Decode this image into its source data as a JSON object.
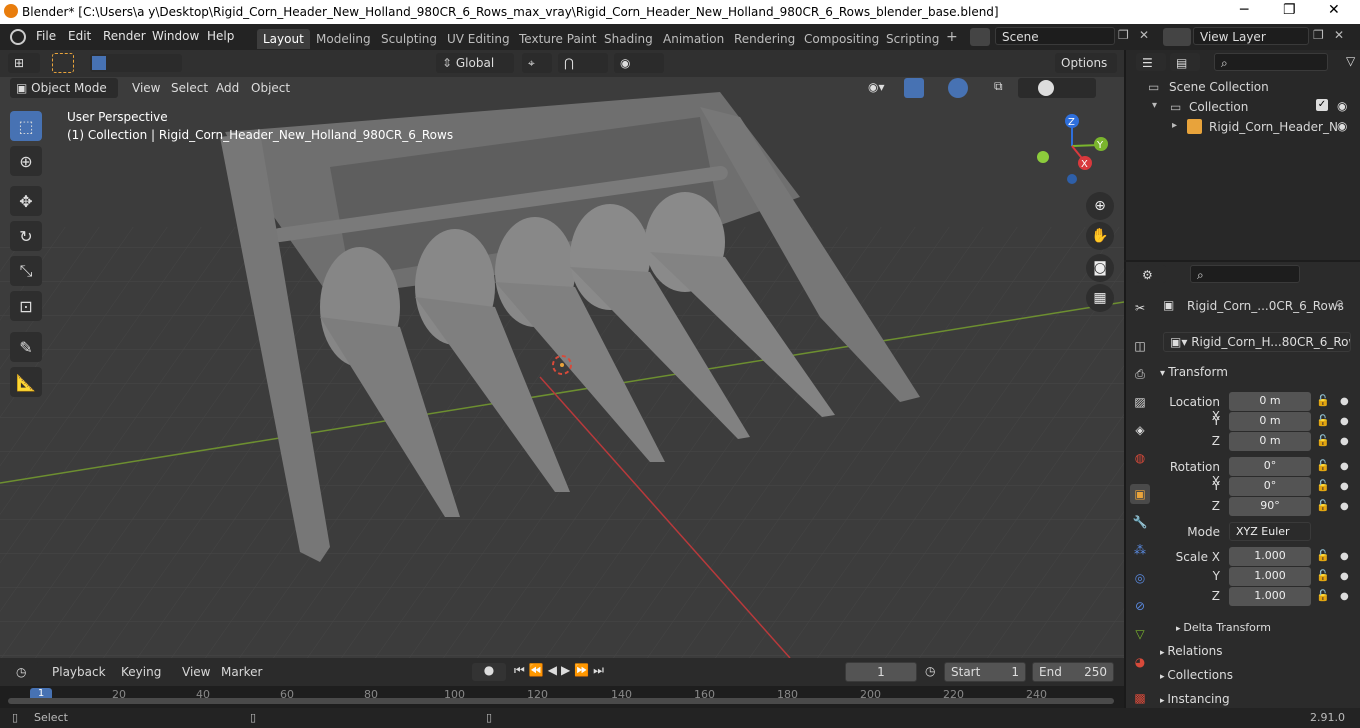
{
  "window": {
    "title": "Blender* [C:\\Users\\a y\\Desktop\\Rigid_Corn_Header_New_Holland_980CR_6_Rows_max_vray\\Rigid_Corn_Header_New_Holland_980CR_6_Rows_blender_base.blend]",
    "minimize": "─",
    "maximize": "❐",
    "close": "✕"
  },
  "menubar": [
    "File",
    "Edit",
    "Render",
    "Window",
    "Help"
  ],
  "workspaces": [
    "Layout",
    "Modeling",
    "Sculpting",
    "UV Editing",
    "Texture Paint",
    "Shading",
    "Animation",
    "Rendering",
    "Compositing",
    "Scripting"
  ],
  "scene": "Scene",
  "view_layer": "View Layer",
  "toolbar": {
    "orientation": "Global",
    "options": "Options"
  },
  "viewport_header": {
    "mode": "Object Mode",
    "menus": [
      "View",
      "Select",
      "Add",
      "Object"
    ]
  },
  "viewport": {
    "perspective": "User Perspective",
    "collection_info": "(1) Collection | Rigid_Corn_Header_New_Holland_980CR_6_Rows",
    "gizmo": {
      "x": "X",
      "y": "Y",
      "z": "Z"
    }
  },
  "outliner": {
    "scene_collection": "Scene Collection",
    "collection": "Collection",
    "object": "Rigid_Corn_Header_N"
  },
  "properties": {
    "object_name": "Rigid_Corn_...0CR_6_Rows",
    "data_name": "Rigid_Corn_H...80CR_6_Rows",
    "transform_title": "Transform",
    "location_label": "Location X",
    "rotation_label": "Rotation X",
    "scale_label": "Scale X",
    "y_label": "Y",
    "z_label": "Z",
    "location": [
      "0 m",
      "0 m",
      "0 m"
    ],
    "rotation": [
      "0°",
      "0°",
      "90°"
    ],
    "mode_label": "Mode",
    "mode": "XYZ Euler",
    "scale": [
      "1.000",
      "1.000",
      "1.000"
    ],
    "delta": "Delta Transform",
    "sections": [
      "Relations",
      "Collections",
      "Instancing"
    ]
  },
  "timeline": {
    "menus": [
      "Playback",
      "Keying",
      "View",
      "Marker"
    ],
    "current_frame": "1",
    "start_label": "Start",
    "start": "1",
    "end_label": "End",
    "end": "250",
    "ruler": [
      "1",
      "20",
      "40",
      "60",
      "80",
      "100",
      "120",
      "140",
      "160",
      "180",
      "200",
      "220",
      "240"
    ]
  },
  "status": {
    "left": "Select",
    "version": "2.91.0"
  },
  "colors": {
    "accent": "#4772b3",
    "x_axis": "#d9393d",
    "y_axis": "#7ab52d",
    "z_axis": "#2e6fdc"
  }
}
